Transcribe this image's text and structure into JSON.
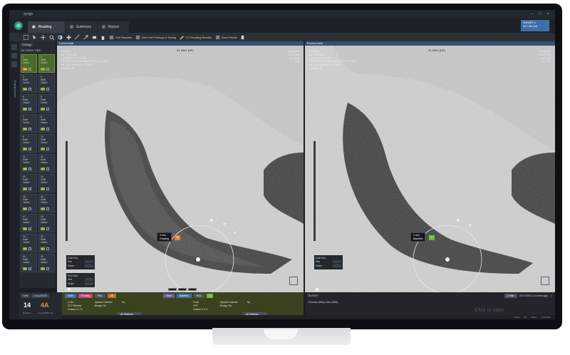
{
  "window": {
    "title": "syngo"
  },
  "tabs": [
    {
      "label": "Reading"
    },
    {
      "label": "Summary"
    },
    {
      "label": "Report"
    }
  ],
  "patient": {
    "line1": "ROBERT X",
    "line2": "34 Y 85Y (M)"
  },
  "toolbar": {
    "items": [
      {
        "label": "Cell Readers"
      },
      {
        "label": "Add Cell Findings & Timing"
      },
      {
        "label": "CT Reading Results"
      },
      {
        "label": "Save Result"
      }
    ]
  },
  "rail": {
    "vertical_label": "Finding Review"
  },
  "findings": {
    "header": [
      "Findings",
      "2017/05/25",
      "TIMS"
    ],
    "cards": [
      {
        "n": "1",
        "type": "Solid",
        "extra": "Lesion",
        "lr": "4A",
        "lr_color": "orange",
        "selected": true
      },
      {
        "n": "2",
        "type": "Solid",
        "extra": "Lesion",
        "lr": "3",
        "lr_color": "green",
        "selected": true
      },
      {
        "n": "3",
        "type": "Solid",
        "extra": "Lesion",
        "lr": "2",
        "lr_color": "green"
      },
      {
        "n": "4",
        "type": "Solid",
        "extra": "Lesion",
        "lr": "2",
        "lr_color": "green"
      },
      {
        "n": "5",
        "type": "Solid",
        "extra": "Lesion",
        "lr": "3",
        "lr_color": "green"
      },
      {
        "n": "6",
        "type": "Solid",
        "extra": "Lesion",
        "lr": "2",
        "lr_color": "green"
      },
      {
        "n": "7",
        "type": "Solid",
        "extra": "Lesion",
        "lr": "2",
        "lr_color": "green"
      },
      {
        "n": "8",
        "type": "Solid",
        "extra": "Lesion",
        "lr": "2",
        "lr_color": "green"
      },
      {
        "n": "9",
        "type": "Solid",
        "extra": "Lesion",
        "lr": "2",
        "lr_color": "green"
      },
      {
        "n": "10",
        "type": "Solid",
        "extra": "Lesion",
        "lr": "2",
        "lr_color": "green"
      },
      {
        "n": "11",
        "type": "Solid",
        "extra": "Lesion",
        "lr": "2",
        "lr_color": "green"
      },
      {
        "n": "12",
        "type": "Solid",
        "extra": "Lesion",
        "lr": "2",
        "lr_color": "green"
      },
      {
        "n": "13",
        "type": "Solid",
        "extra": "Lesion",
        "lr": "2",
        "lr_color": "green"
      },
      {
        "n": "14",
        "type": "Solid",
        "extra": "Lesion",
        "lr": "2",
        "lr_color": "green"
      },
      {
        "n": "15",
        "type": "Solid",
        "extra": "Lesion",
        "lr": "2",
        "lr_color": "green"
      },
      {
        "n": "16",
        "type": "Solid",
        "extra": "Lesion",
        "lr": "2",
        "lr_color": "green"
      },
      {
        "n": "17",
        "type": "Solid",
        "extra": "Lesion",
        "lr": "2",
        "lr_color": "green"
      },
      {
        "n": "18",
        "type": "Solid",
        "extra": "Lesion",
        "lr": "2",
        "lr_color": "green"
      },
      {
        "n": "19",
        "type": "Solid",
        "extra": "Lesion",
        "lr": "2",
        "lr_color": "green"
      },
      {
        "n": "20",
        "type": "Solid",
        "extra": "Lesion",
        "lr": "2",
        "lr_color": "green"
      },
      {
        "n": "21",
        "type": "Solid",
        "extra": "Lesion",
        "lr": "2",
        "lr_color": "green"
      },
      {
        "n": "22",
        "type": "Solid",
        "extra": "Lesion",
        "lr": "2",
        "lr_color": "green"
      }
    ]
  },
  "score": {
    "tab1": "Total",
    "tab2": "Lung-RADS",
    "count": "14",
    "count_label": "Nodules",
    "category": "4A",
    "category_label": "Lung-RADS 1.0"
  },
  "left_viewport": {
    "header": "Current Axial",
    "overlay_text": "ST0031\n0Y / 43Y (M)\n2018/03/13 14:17:58\nSTD/Siemens Research (UCAN) Acad\n[4] Cell Lowdose 1.0 Br59 3\nSeries#: 6",
    "overlay_right": "Topogram\n1mm/mm\nW: 1200\nL: -700",
    "series_label": "SL 8362 [HP]",
    "tooltip": "4 mm\nGrowing",
    "nodule_label": "4A",
    "solid_part_title": "Solid Part",
    "solid_rows": [
      "Size",
      "Shape"
    ],
    "part_solid_title": "Part Solid",
    "part_rows": [
      "Size",
      "Shape"
    ],
    "checkbox_label": "Relevant Result"
  },
  "right_viewport": {
    "header": "Previous Axial",
    "overlay_text": "ST0031\n0Y / 43Y (M)\n2017/05/25 15:11\nSTD/Siemens Research (UCAN) Acad\n[4] Cell Lowdose 1.0 Br59 3\nSeries#: 6",
    "overlay_right": "Topogram\nTHIN 9mm\nW: 1200\nL: -700",
    "series_label": "SL 8362 [HP]",
    "tooltip": "4 mm\nBaseline",
    "nodule_label": "3",
    "solid_part_title": "Solid Part",
    "solid_rows": [
      "Size",
      "Shape"
    ],
    "checkbox_label": "Relevant Result"
  },
  "bottom_left": {
    "pills": [
      "Solid",
      "Growing",
      "RUL",
      "4A"
    ],
    "pills2": [
      "Solid",
      "Baseline",
      "RUL",
      "3"
    ],
    "info1": "4 mm\nVDT Window\nVolume 0.1 %",
    "info1b": "Spiculin Calcium\nBenign Cls",
    "info1c": "No",
    "info2": "4 mm\nVDT\nVolume 0.1 %",
    "info2b": "Spiculin Calcium\nBenign Cls",
    "info2c": "No",
    "findings_btn": "All Findings"
  },
  "bottom_right": {
    "id": "2B-ING01",
    "interval_label": "1 Year",
    "date": "2017/10/24 (1 months ago)",
    "row": "Coronary Artery Calc (HMS)",
    "placeholder": "Click to open"
  },
  "statusbar": [
    "Noise",
    "0%",
    "Study",
    "Left Panel"
  ]
}
